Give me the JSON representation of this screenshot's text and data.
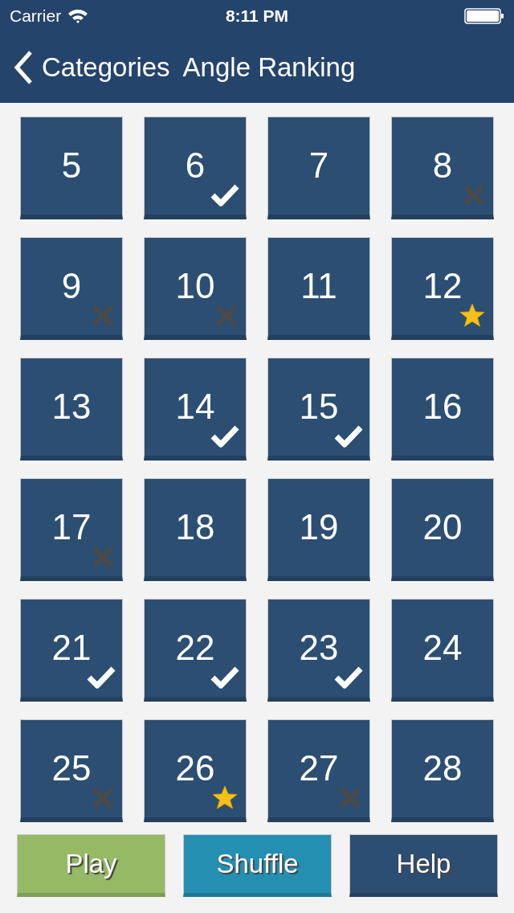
{
  "status_bar": {
    "carrier": "Carrier",
    "time": "8:11 PM"
  },
  "nav": {
    "back_label": "Categories",
    "title": "Angle Ranking"
  },
  "levels": [
    {
      "number": "5",
      "kind": "plain"
    },
    {
      "number": "6",
      "kind": "correct"
    },
    {
      "number": "7",
      "kind": "plain"
    },
    {
      "number": "8",
      "kind": "wrong"
    },
    {
      "number": "9",
      "kind": "wrong"
    },
    {
      "number": "10",
      "kind": "wrong"
    },
    {
      "number": "11",
      "kind": "plain"
    },
    {
      "number": "12",
      "kind": "star"
    },
    {
      "number": "13",
      "kind": "plain"
    },
    {
      "number": "14",
      "kind": "correct"
    },
    {
      "number": "15",
      "kind": "correct"
    },
    {
      "number": "16",
      "kind": "plain"
    },
    {
      "number": "17",
      "kind": "wrong"
    },
    {
      "number": "18",
      "kind": "plain"
    },
    {
      "number": "19",
      "kind": "plain"
    },
    {
      "number": "20",
      "kind": "plain"
    },
    {
      "number": "21",
      "kind": "correct"
    },
    {
      "number": "22",
      "kind": "correct"
    },
    {
      "number": "23",
      "kind": "correct"
    },
    {
      "number": "24",
      "kind": "plain"
    },
    {
      "number": "25",
      "kind": "wrong"
    },
    {
      "number": "26",
      "kind": "star"
    },
    {
      "number": "27",
      "kind": "wrong"
    },
    {
      "number": "28",
      "kind": "plain"
    }
  ],
  "buttons": [
    {
      "label": "Play",
      "color": "#95b965"
    },
    {
      "label": "Shuffle",
      "color": "#258fb1"
    },
    {
      "label": "Help",
      "color": "#2c4e72"
    }
  ]
}
